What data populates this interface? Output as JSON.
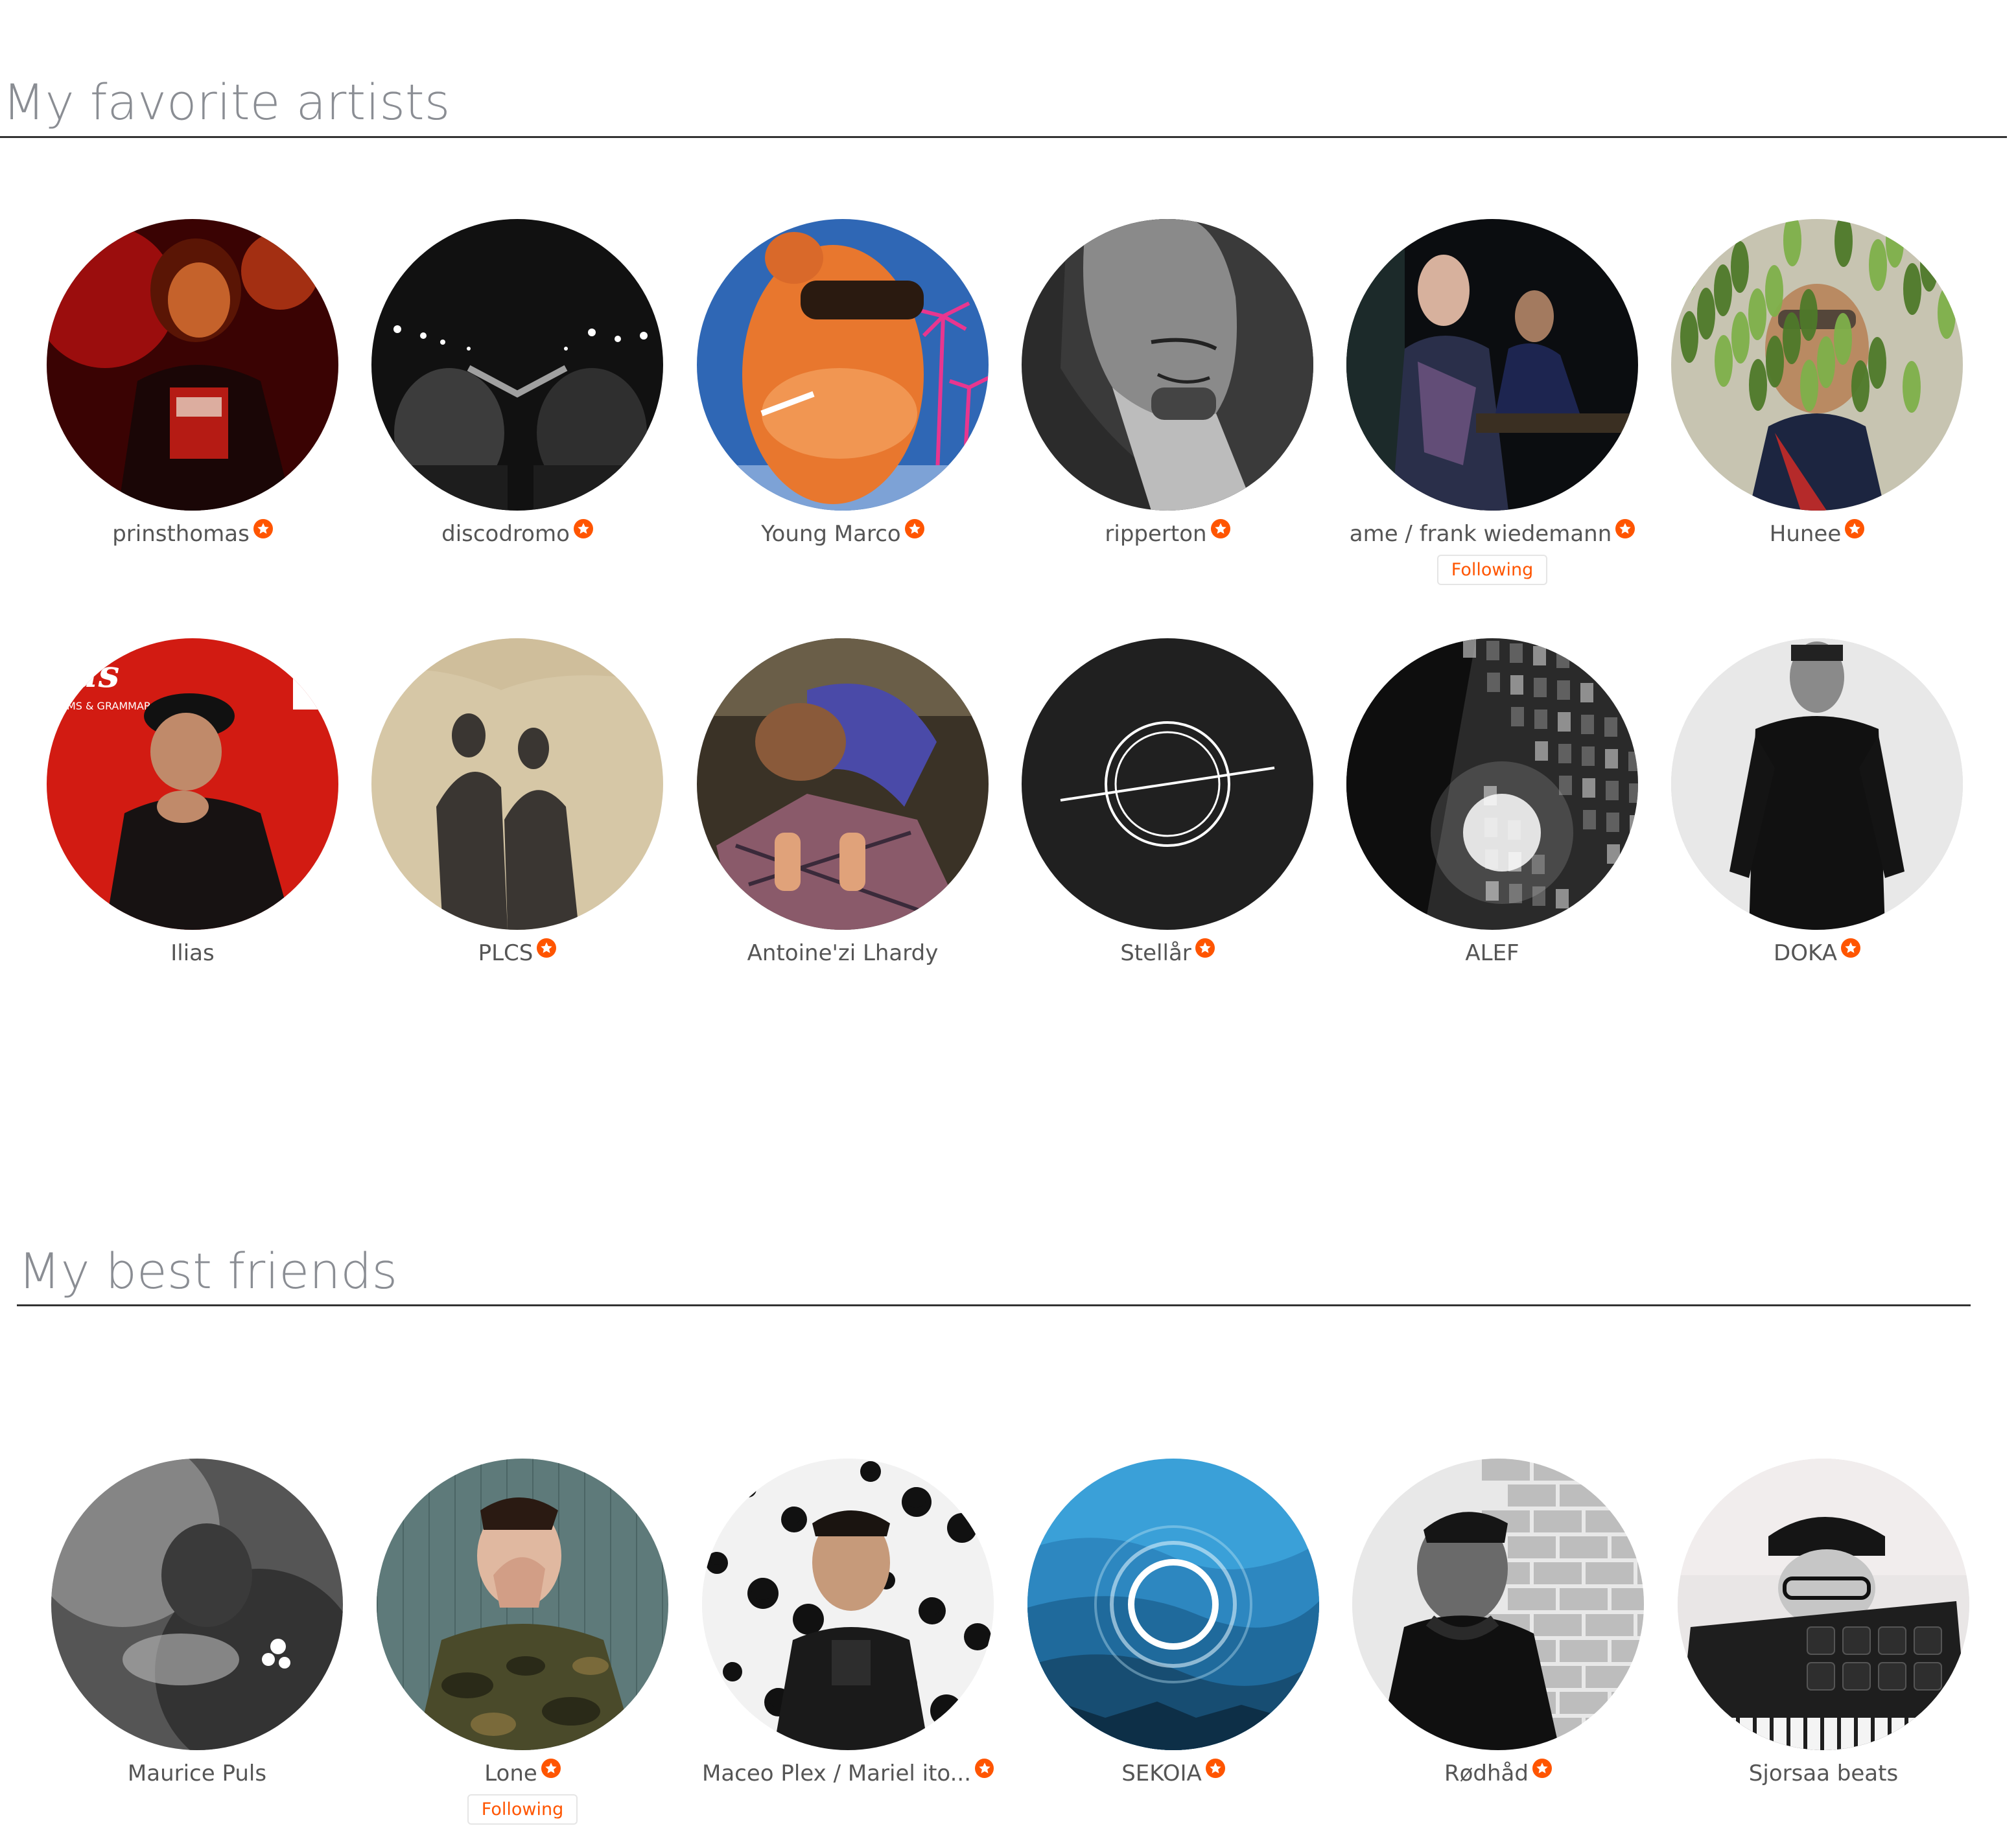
{
  "sections": [
    {
      "title": "My favorite artists",
      "artists": [
        {
          "name": "prinsthomas",
          "pro": true,
          "following": false,
          "art": "red-portrait"
        },
        {
          "name": "discodromo",
          "pro": true,
          "following": false,
          "art": "bw-duo-night"
        },
        {
          "name": "Young Marco",
          "pro": true,
          "following": false,
          "art": "camel-cartoon"
        },
        {
          "name": "ripperton",
          "pro": true,
          "following": false,
          "art": "grey-drawing"
        },
        {
          "name": "ame / frank wiedemann",
          "pro": true,
          "following": true,
          "art": "dark-duo"
        },
        {
          "name": "Hunee",
          "pro": true,
          "following": false,
          "art": "plant-portrait"
        },
        {
          "name": "Ilias",
          "pro": false,
          "following": false,
          "art": "red-cover"
        },
        {
          "name": "PLCS",
          "pro": true,
          "following": false,
          "art": "sand-shadows"
        },
        {
          "name": "Antoine'zi Lhardy",
          "pro": false,
          "following": false,
          "art": "bent-over-photo"
        },
        {
          "name": "Stellår",
          "pro": true,
          "following": false,
          "art": "planet-logo"
        },
        {
          "name": "ALEF",
          "pro": false,
          "following": false,
          "art": "bw-city"
        },
        {
          "name": "DOKA",
          "pro": true,
          "following": false,
          "art": "bw-man-black"
        }
      ]
    },
    {
      "title": "My best friends",
      "artists": [
        {
          "name": "Maurice Puls",
          "pro": false,
          "following": false,
          "art": "bw-smoke"
        },
        {
          "name": "Lone",
          "pro": true,
          "following": true,
          "art": "camo-facepalm"
        },
        {
          "name": "Maceo Plex / Mariel ito...",
          "pro": true,
          "following": false,
          "art": "dots-portrait"
        },
        {
          "name": "SEKOIA",
          "pro": true,
          "following": false,
          "art": "blue-mountains"
        },
        {
          "name": "Rødhåd",
          "pro": true,
          "following": false,
          "art": "bw-brick"
        },
        {
          "name": "Sjorsaa beats",
          "pro": false,
          "following": false,
          "art": "synth-cap"
        }
      ]
    }
  ],
  "labels": {
    "following": "Following"
  },
  "colors": {
    "accent": "#ff5500",
    "title": "#8a8d93",
    "name": "#555555",
    "rule": "#333333"
  }
}
